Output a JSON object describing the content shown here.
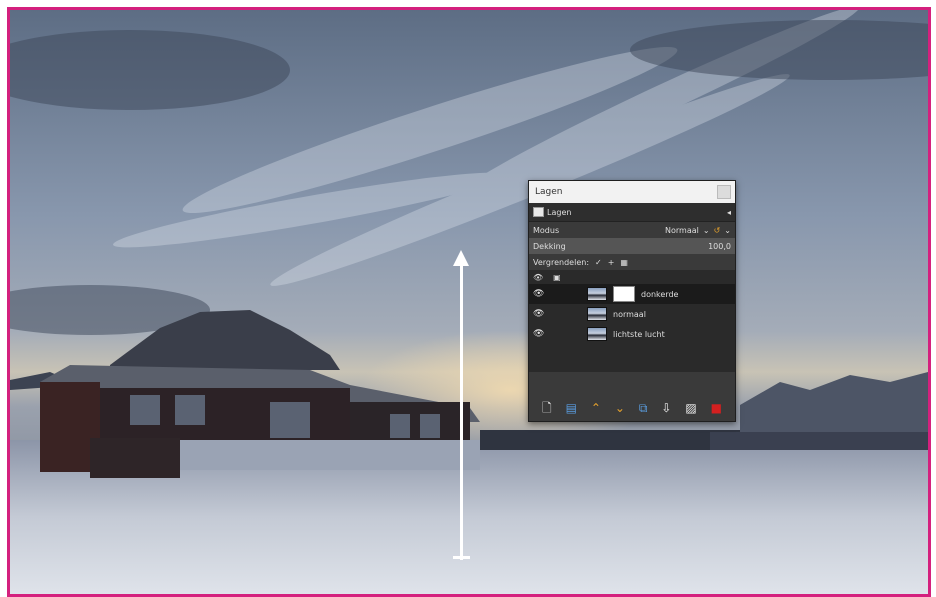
{
  "dialog": {
    "title": "Lagen",
    "tab_label": "Lagen",
    "tab_menu_icon": "tab-menu-icon",
    "mode_label": "Modus",
    "mode_value": "Normaal",
    "opacity_label": "Dekking",
    "opacity_value": "100,0",
    "lock_label": "Vergrendelen:",
    "layers": [
      {
        "name": "donkerde",
        "selected": true,
        "has_mask": true
      },
      {
        "name": "normaal",
        "selected": false,
        "has_mask": false
      },
      {
        "name": "lichtste lucht",
        "selected": false,
        "has_mask": false
      }
    ],
    "toolbar_icons": [
      "new-layer-icon",
      "new-layer-group-icon",
      "raise-layer-icon",
      "lower-layer-icon",
      "duplicate-layer-icon",
      "anchor-layer-icon",
      "add-mask-icon",
      "delete-layer-icon"
    ]
  },
  "colors": {
    "frame": "#d4207e",
    "accent": "#e8a32c",
    "panel_bg": "#3a3a3a",
    "arrow": "#ffffff"
  }
}
